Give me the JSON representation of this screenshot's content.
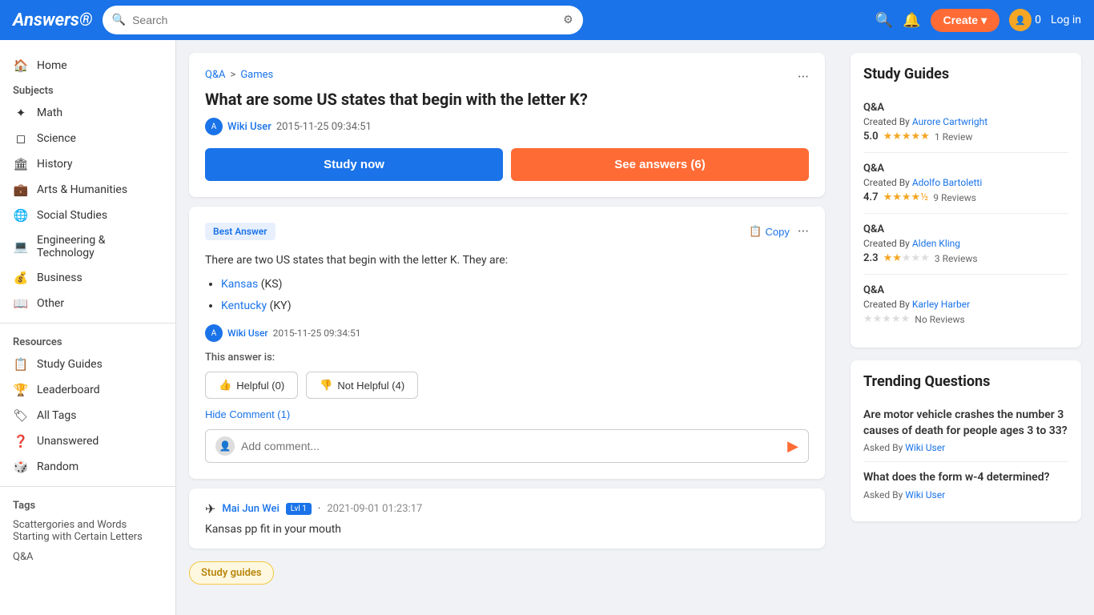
{
  "header": {
    "logo": "Answers®",
    "search_placeholder": "Search",
    "create_label": "Create",
    "coin_count": "0",
    "login_label": "Log in"
  },
  "sidebar": {
    "home_label": "Home",
    "subjects_label": "Subjects",
    "subjects": [
      {
        "icon": "✦",
        "label": "Math"
      },
      {
        "icon": "◻",
        "label": "Science"
      },
      {
        "icon": "🏛",
        "label": "History"
      },
      {
        "icon": "💼",
        "label": "Arts & Humanities"
      },
      {
        "icon": "🌐",
        "label": "Social Studies"
      },
      {
        "icon": "💻",
        "label": "Engineering & Technology"
      },
      {
        "icon": "💰",
        "label": "Business"
      },
      {
        "icon": "📖",
        "label": "Other"
      }
    ],
    "resources_label": "Resources",
    "resources": [
      {
        "icon": "📋",
        "label": "Study Guides"
      },
      {
        "icon": "🏆",
        "label": "Leaderboard"
      },
      {
        "icon": "🏷",
        "label": "All Tags"
      },
      {
        "icon": "❓",
        "label": "Unanswered"
      },
      {
        "icon": "🎲",
        "label": "Random"
      }
    ],
    "tags_label": "Tags",
    "tags": [
      {
        "label": "Scattergories and Words Starting with Certain Letters"
      },
      {
        "label": "Q&A"
      }
    ]
  },
  "question": {
    "breadcrumb_qa": "Q&A",
    "breadcrumb_sep": ">",
    "breadcrumb_category": "Games",
    "title": "What are some US states that begin with the letter K?",
    "author": "Wiki User",
    "date": "2015-11-25 09:34:51",
    "study_now_label": "Study now",
    "see_answers_label": "See answers (6)"
  },
  "answer": {
    "best_answer_label": "Best Answer",
    "copy_label": "Copy",
    "body_intro": "There are two US states that begin with the letter K. They are:",
    "states": [
      {
        "name": "Kansas",
        "abbr": "(KS)"
      },
      {
        "name": "Kentucky",
        "abbr": "(KY)"
      }
    ],
    "author": "Wiki User",
    "date": "2015-11-25 09:34:51",
    "verdict_label": "This answer is:",
    "helpful_label": "Helpful (0)",
    "not_helpful_label": "Not Helpful (4)",
    "hide_comment_label": "Hide Comment (1)",
    "comment_placeholder": "Add comment...",
    "comment_user_icon": "👤"
  },
  "user_comment": {
    "commenter_name": "Mai Jun Wei",
    "level": "Lvl 1",
    "date": "2021-09-01 01:23:17",
    "body": "Kansas pp fit in your mouth",
    "commenter_icon": "✈"
  },
  "study_guides_section": {
    "title": "Study Guides",
    "badge_label": "Study guides",
    "items": [
      {
        "type": "Q&A",
        "created_by": "Created By",
        "creator": "Aurore Cartwright",
        "rating": "5.0",
        "stars_filled": 5,
        "stars_empty": 0,
        "reviews": "1 Review"
      },
      {
        "type": "Q&A",
        "created_by": "Created By",
        "creator": "Adolfo Bartoletti",
        "rating": "4.7",
        "stars_filled": 4,
        "stars_half": 1,
        "stars_empty": 0,
        "reviews": "9 Reviews"
      },
      {
        "type": "Q&A",
        "created_by": "Created By",
        "creator": "Alden Kling",
        "rating": "2.3",
        "stars_filled": 2,
        "stars_empty": 3,
        "reviews": "3 Reviews"
      },
      {
        "type": "Q&A",
        "created_by": "Created By",
        "creator": "Karley Harber",
        "rating": "",
        "stars_filled": 0,
        "stars_empty": 5,
        "reviews": "No Reviews"
      }
    ]
  },
  "trending_questions": {
    "title": "Trending Questions",
    "items": [
      {
        "question": "Are motor vehicle crashes the number 3 causes of death for people ages 3 to 33?",
        "asked_by": "Asked By",
        "asker": "Wiki User"
      },
      {
        "question": "What does the form w-4 determined?",
        "asked_by": "Asked By",
        "asker": "Wiki User"
      }
    ]
  }
}
